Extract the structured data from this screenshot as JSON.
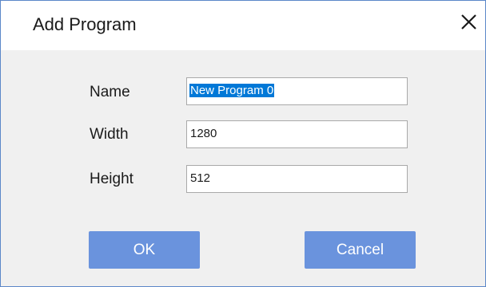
{
  "dialog": {
    "title": "Add Program",
    "close_icon": "close-icon"
  },
  "form": {
    "name_label": "Name",
    "name_value": "New Program 0",
    "width_label": "Width",
    "width_value": "1280",
    "height_label": "Height",
    "height_value": "512"
  },
  "buttons": {
    "ok": "OK",
    "cancel": "Cancel"
  },
  "colors": {
    "border": "#5b87c9",
    "button": "#6a93dd",
    "selection": "#0078d7"
  }
}
